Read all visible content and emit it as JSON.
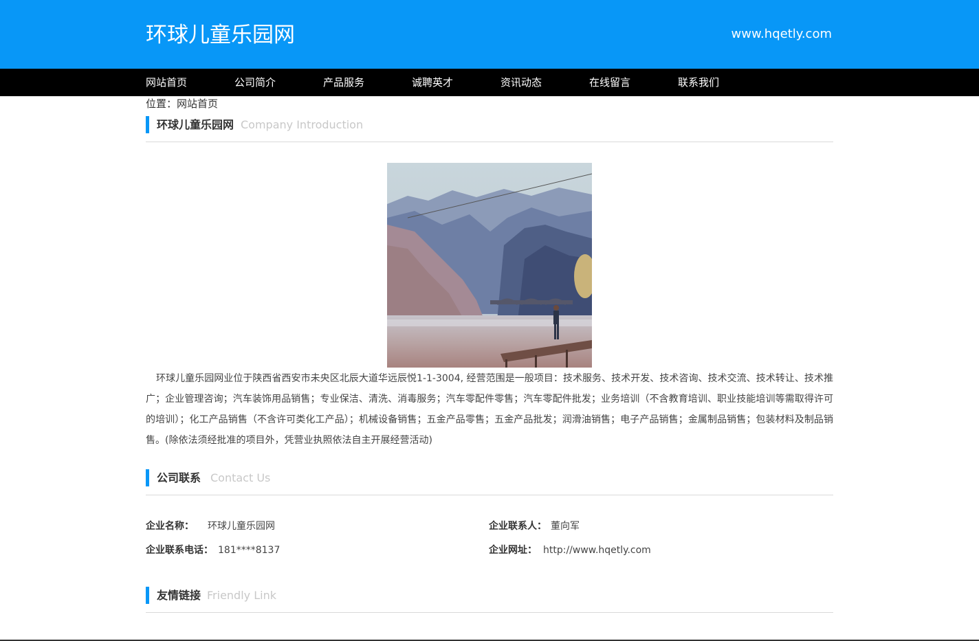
{
  "header": {
    "site_title": "环球儿童乐园网",
    "domain": "www.hqetly.com"
  },
  "nav": {
    "items": [
      "网站首页",
      "公司简介",
      "产品服务",
      "诚聘英才",
      "资讯动态",
      "在线留言",
      "联系我们"
    ]
  },
  "breadcrumb": {
    "text": "位置：网站首页"
  },
  "sections": {
    "intro": {
      "title": "环球儿童乐园网",
      "subtitle": "Company Introduction"
    },
    "contact": {
      "title": "公司联系",
      "subtitle": "Contact Us"
    },
    "links": {
      "title": "友情链接",
      "subtitle": "Friendly Link"
    }
  },
  "intro_text": "环球儿童乐园网业位于陕西省西安市未央区北辰大道华远辰悦1-1-3004, 经营范围是一般项目：技术服务、技术开发、技术咨询、技术交流、技术转让、技术推广；企业管理咨询；汽车装饰用品销售；专业保洁、清洗、消毒服务；汽车零配件零售；汽车零配件批发；业务培训（不含教育培训、职业技能培训等需取得许可的培训）；化工产品销售（不含许可类化工产品）；机械设备销售；五金产品零售；五金产品批发；润滑油销售；电子产品销售；金属制品销售；包装材料及制品销售。(除依法须经批准的项目外，凭营业执照依法自主开展经营活动)",
  "contact": {
    "company_label": "企业名称：",
    "company_value": "环球儿童乐园网",
    "person_label": "企业联系人：",
    "person_value": "董向军",
    "phone_label": "企业联系电话：",
    "phone_value": "181****8137",
    "website_label": "企业网址：",
    "website_value": "http://www.hqetly.com"
  },
  "colors": {
    "brand_blue": "#0897f7",
    "nav_black": "#000000"
  }
}
